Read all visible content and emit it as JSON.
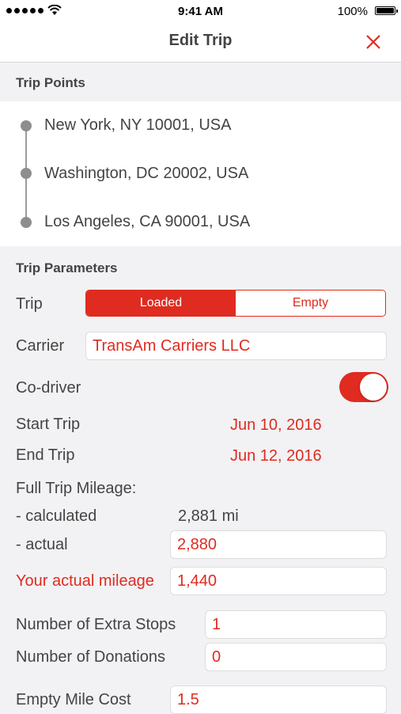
{
  "status_bar": {
    "time": "9:41 AM",
    "battery": "100%"
  },
  "nav": {
    "title": "Edit Trip"
  },
  "trip_points": {
    "header": "Trip Points",
    "points": [
      "New York, NY 10001, USA",
      "Washington, DC 20002, USA",
      "Los Angeles, CA 90001, USA"
    ]
  },
  "params": {
    "header": "Trip Parameters",
    "trip_label": "Trip",
    "trip_options": [
      "Loaded",
      "Empty"
    ],
    "trip_selected": "Loaded",
    "carrier_label": "Carrier",
    "carrier_value": "TransAm Carriers LLC",
    "codriver_label": "Co-driver",
    "codriver_on": true,
    "start_label": "Start Trip",
    "start_value": "Jun 10, 2016",
    "end_label": "End Trip",
    "end_value": "Jun 12, 2016",
    "mileage_label": "Full Trip Mileage:",
    "calculated_label": "- calculated",
    "calculated_value": "2,881 mi",
    "actual_label": "- actual",
    "actual_value": "2,880",
    "your_mileage_label": "Your actual mileage",
    "your_mileage_value": "1,440",
    "extra_stops_label": "Number of Extra Stops",
    "extra_stops_value": "1",
    "donations_label": "Number of Donations",
    "donations_value": "0",
    "empty_mile_label": "Empty Mile Cost",
    "empty_mile_value": "1.5"
  },
  "colors": {
    "accent": "#e02b20",
    "background": "#f2f2f4"
  }
}
